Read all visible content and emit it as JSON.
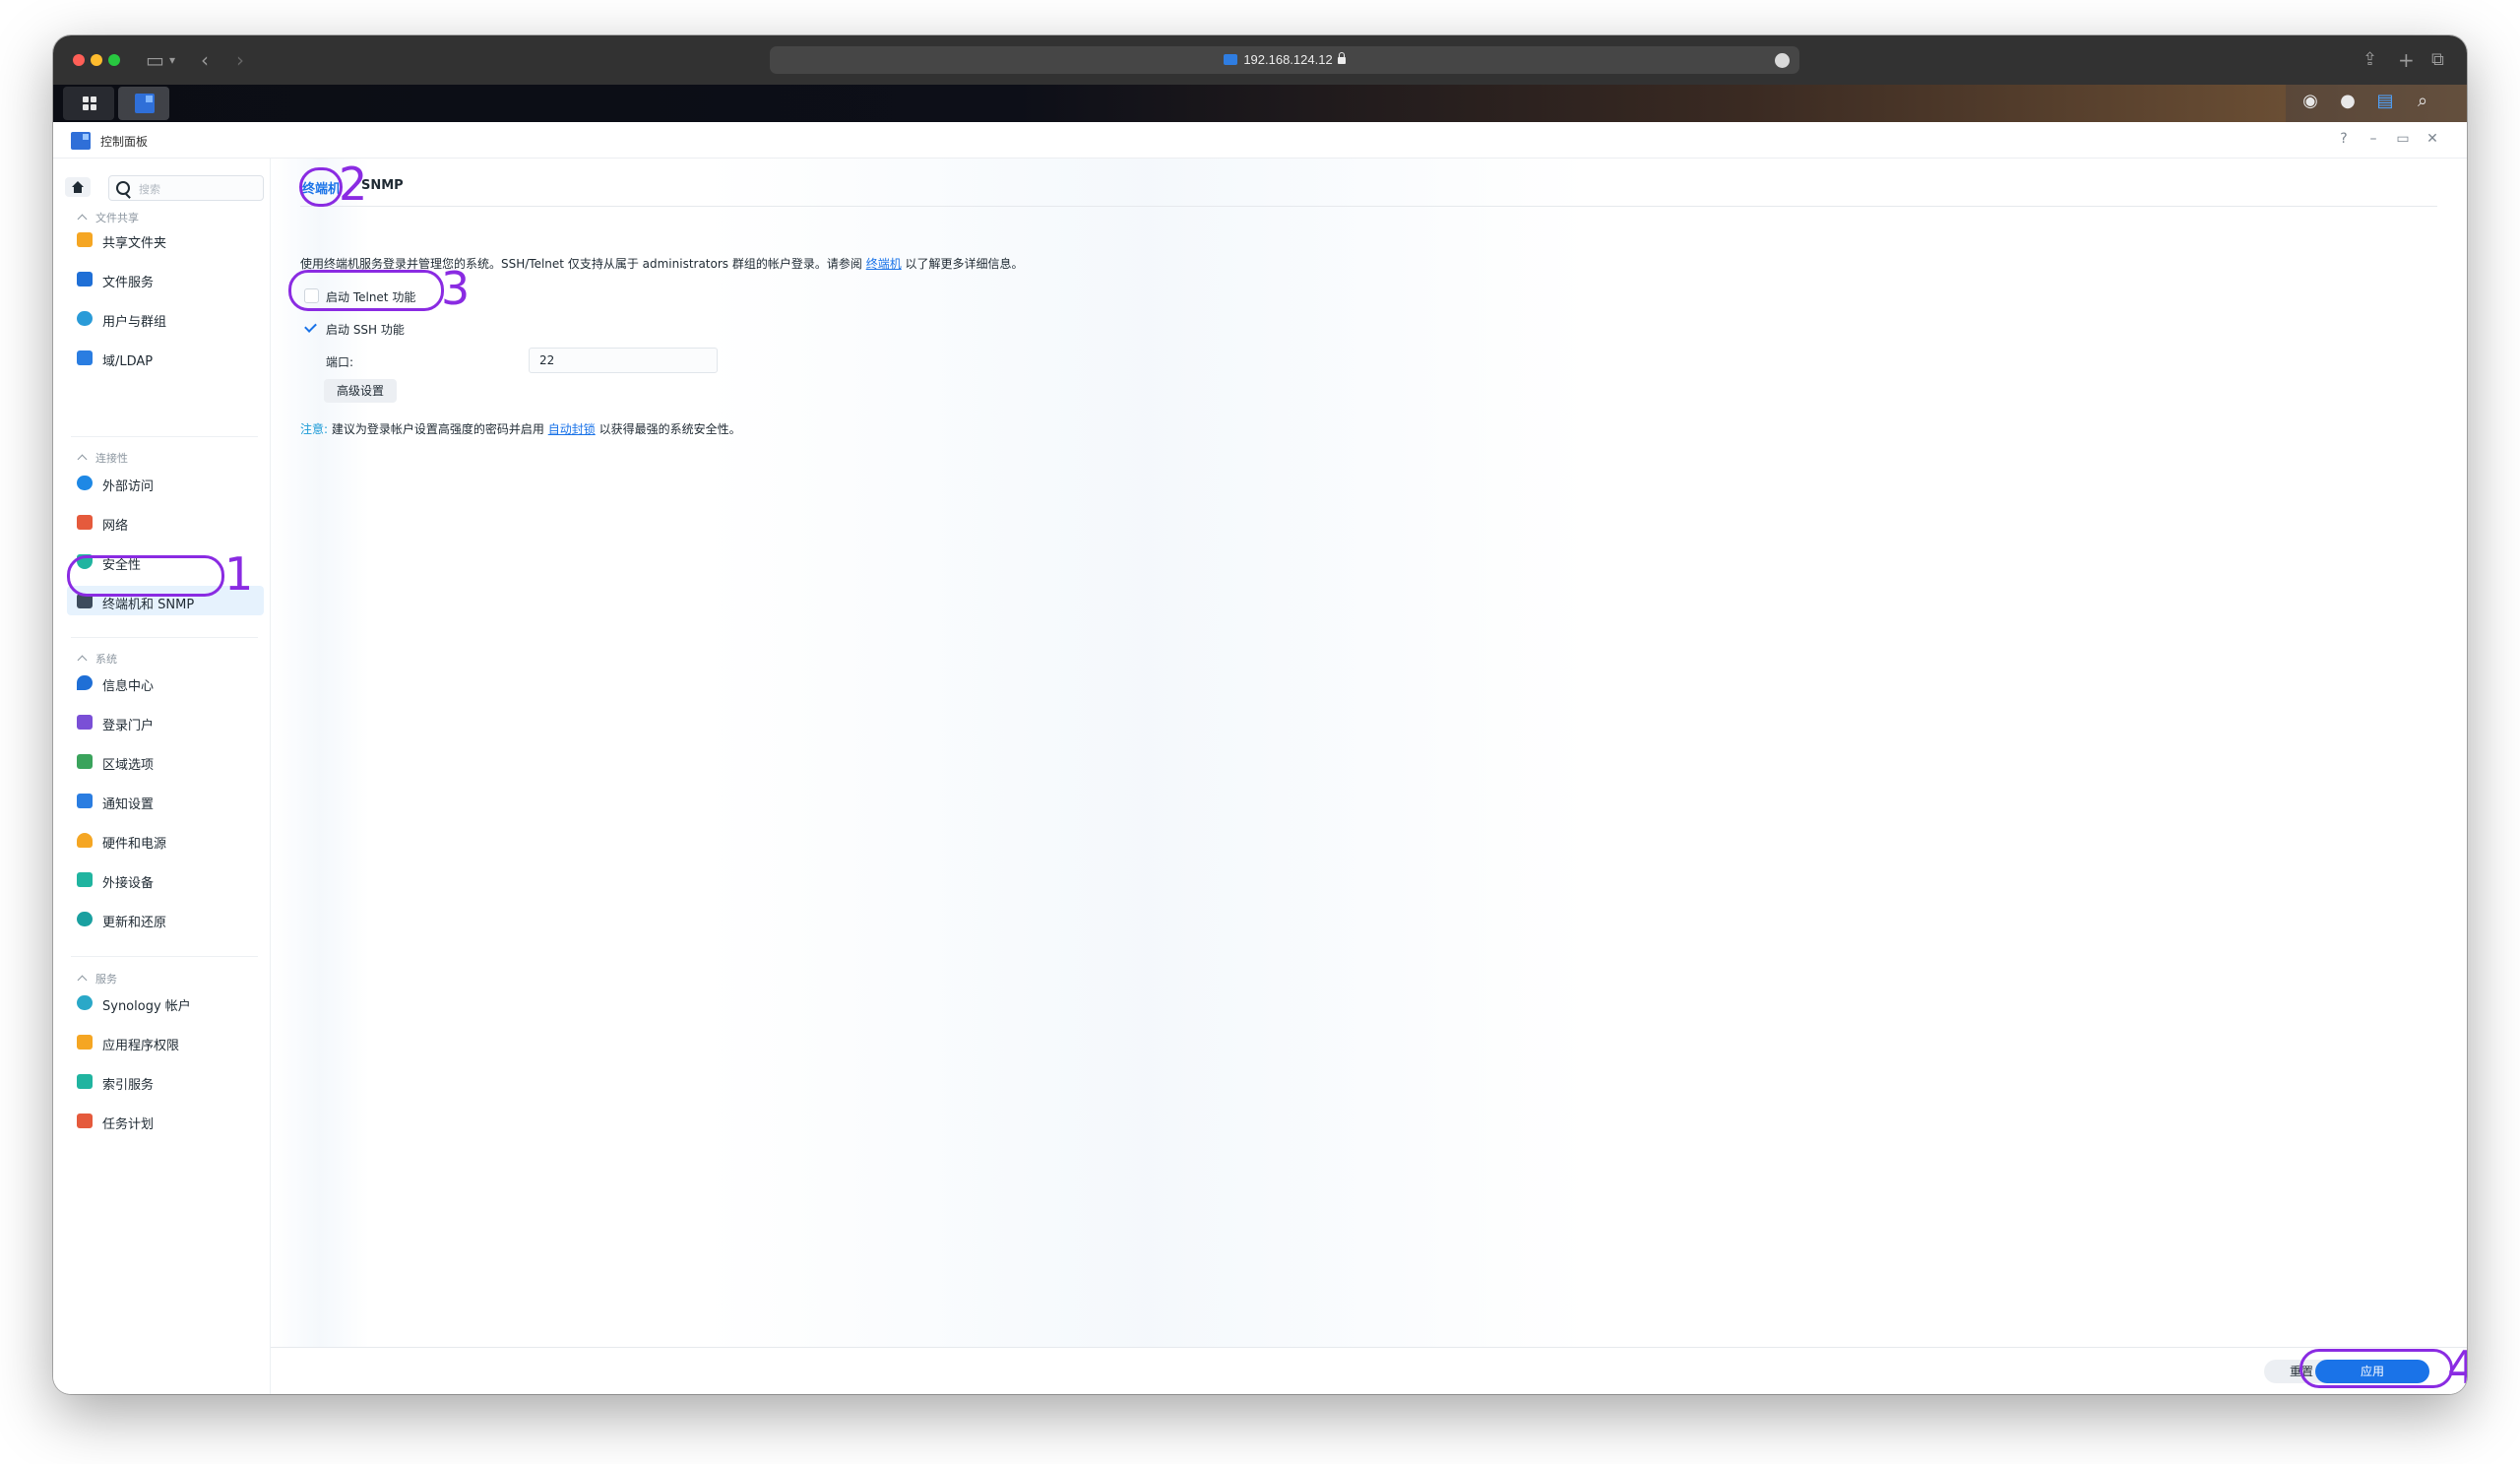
{
  "browser": {
    "url": "192.168.124.12",
    "icons": [
      "sidebar-icon",
      "chevron-left-icon",
      "chevron-right-icon",
      "share-icon",
      "plus-icon",
      "tabs-icon"
    ]
  },
  "taskbar": {
    "tray_icons": [
      "chat-icon",
      "user-icon",
      "widgets-icon",
      "search-icon"
    ]
  },
  "app": {
    "title": "控制面板",
    "window_controls": [
      "?",
      "–",
      "▭",
      "✕"
    ]
  },
  "sidebar": {
    "search_placeholder": "搜索",
    "sections": [
      {
        "title": "文件共享",
        "items": [
          {
            "label": "共享文件夹",
            "icon": "folder-icon",
            "color": "#f5a623"
          },
          {
            "label": "文件服务",
            "icon": "file-services-icon",
            "color": "#1f6fd6"
          },
          {
            "label": "用户与群组",
            "icon": "users-icon",
            "color": "#2a9bd8"
          },
          {
            "label": "域/LDAP",
            "icon": "ldap-icon",
            "color": "#2a7de1"
          }
        ]
      },
      {
        "title": "连接性",
        "items": [
          {
            "label": "外部访问",
            "icon": "external-access-icon",
            "color": "#1e88e5"
          },
          {
            "label": "网络",
            "icon": "network-icon",
            "color": "#e55a3c"
          },
          {
            "label": "安全性",
            "icon": "shield-icon",
            "color": "#20b4a0"
          },
          {
            "label": "终端机和 SNMP",
            "icon": "terminal-icon",
            "color": "#3d4c5c",
            "active": true
          }
        ]
      },
      {
        "title": "系统",
        "items": [
          {
            "label": "信息中心",
            "icon": "info-icon",
            "color": "#1f6fd6"
          },
          {
            "label": "登录门户",
            "icon": "login-portal-icon",
            "color": "#7a4fd6"
          },
          {
            "label": "区域选项",
            "icon": "regional-options-icon",
            "color": "#3aa35c"
          },
          {
            "label": "通知设置",
            "icon": "notification-icon",
            "color": "#2a7de1"
          },
          {
            "label": "硬件和电源",
            "icon": "hardware-power-icon",
            "color": "#f5a623"
          },
          {
            "label": "外接设备",
            "icon": "external-devices-icon",
            "color": "#20b4a0"
          },
          {
            "label": "更新和还原",
            "icon": "update-restore-icon",
            "color": "#1aa0a0"
          }
        ]
      },
      {
        "title": "服务",
        "items": [
          {
            "label": "Synology 帐户",
            "icon": "synology-account-icon",
            "color": "#2aa8c8"
          },
          {
            "label": "应用程序权限",
            "icon": "lock-icon",
            "color": "#f5a623"
          },
          {
            "label": "索引服务",
            "icon": "indexing-icon",
            "color": "#20b4a0"
          },
          {
            "label": "任务计划",
            "icon": "calendar-icon",
            "color": "#e55a3c"
          }
        ]
      }
    ]
  },
  "main": {
    "tabs": [
      {
        "label": "终端机",
        "active": true
      },
      {
        "label": "SNMP",
        "active": false
      }
    ],
    "description_pre": "使用终端机服务登录并管理您的系统。SSH/Telnet 仅支持从属于 administrators 群组的帐户登录。请参阅",
    "description_link": "终端机",
    "description_post": "以了解更多详细信息。",
    "telnet": {
      "label": "启动 Telnet 功能",
      "checked": false
    },
    "ssh": {
      "label": "启动 SSH 功能",
      "checked": true
    },
    "port": {
      "label": "端口:",
      "value": "22"
    },
    "advanced_button": "高级设置",
    "note": {
      "label": "注意:",
      "pre": "建议为登录帐户设置高强度的密码并启用",
      "link": "自动封锁",
      "post": "以获得最强的系统安全性。"
    },
    "reset_button": "重置",
    "apply_button": "应用"
  },
  "annotations": [
    "1",
    "2",
    "3",
    "4"
  ],
  "colors": {
    "accent": "#1a73e8",
    "annotation": "#8a2be2"
  }
}
